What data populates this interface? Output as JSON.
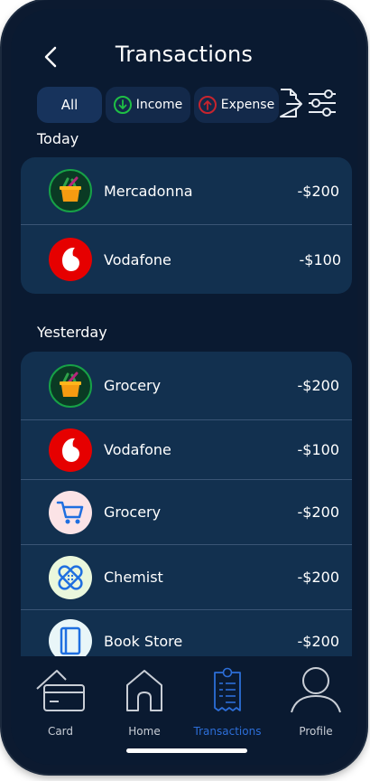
{
  "header": {
    "title": "Transactions"
  },
  "filters": {
    "all": "All",
    "income": "Income",
    "expense": "Expense"
  },
  "sections": [
    {
      "label": "Today",
      "items": [
        {
          "name": "Mercadonna",
          "amount": "-$200",
          "icon": "grocery-basket-icon"
        },
        {
          "name": "Vodafone",
          "amount": "-$100",
          "icon": "vodafone-logo-icon"
        }
      ]
    },
    {
      "label": "Yesterday",
      "items": [
        {
          "name": "Grocery",
          "amount": "-$200",
          "icon": "grocery-basket-icon"
        },
        {
          "name": "Vodafone",
          "amount": "-$100",
          "icon": "vodafone-logo-icon"
        },
        {
          "name": "Grocery",
          "amount": "-$200",
          "icon": "shopping-cart-icon"
        },
        {
          "name": "Chemist",
          "amount": "-$200",
          "icon": "bandage-icon"
        },
        {
          "name": "Book Store",
          "amount": "-$200",
          "icon": "book-icon"
        }
      ]
    }
  ],
  "nav": [
    {
      "label": "Card",
      "icon": "card-icon"
    },
    {
      "label": "Home",
      "icon": "home-icon"
    },
    {
      "label": "Transactions",
      "icon": "receipt-icon",
      "active": true
    },
    {
      "label": "Profile",
      "icon": "profile-icon"
    }
  ],
  "colors": {
    "background": "#0a1a31",
    "card": "#12304f",
    "accent": "#2c6ed8",
    "income": "#1fbf45",
    "expense": "#c8242e"
  }
}
